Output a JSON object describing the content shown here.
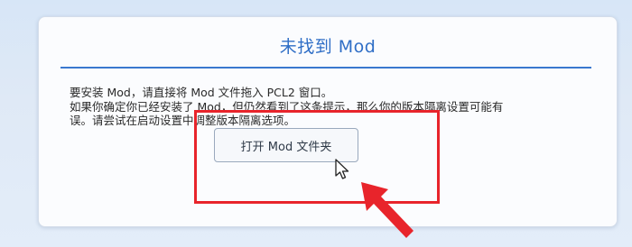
{
  "dialog": {
    "title": "未找到 Mod",
    "message_lines": [
      "要安装 Mod，请直接将 Mod 文件拖入 PCL2 窗口。",
      "如果你确定你已经安装了 Mod，但仍然看到了这条提示，那么你的版本隔离设置可能有",
      "误。请尝试在启动设置中调整版本隔离选项。"
    ],
    "open_folder_button": "打开 Mod 文件夹"
  },
  "annotation": {
    "highlight_color": "#e8242b",
    "icons": [
      "mouse-cursor-icon",
      "arrow-icon"
    ]
  },
  "colors": {
    "accent": "#2f6ec6",
    "divider": "#3a78cf",
    "background": "#dfe9f6"
  }
}
